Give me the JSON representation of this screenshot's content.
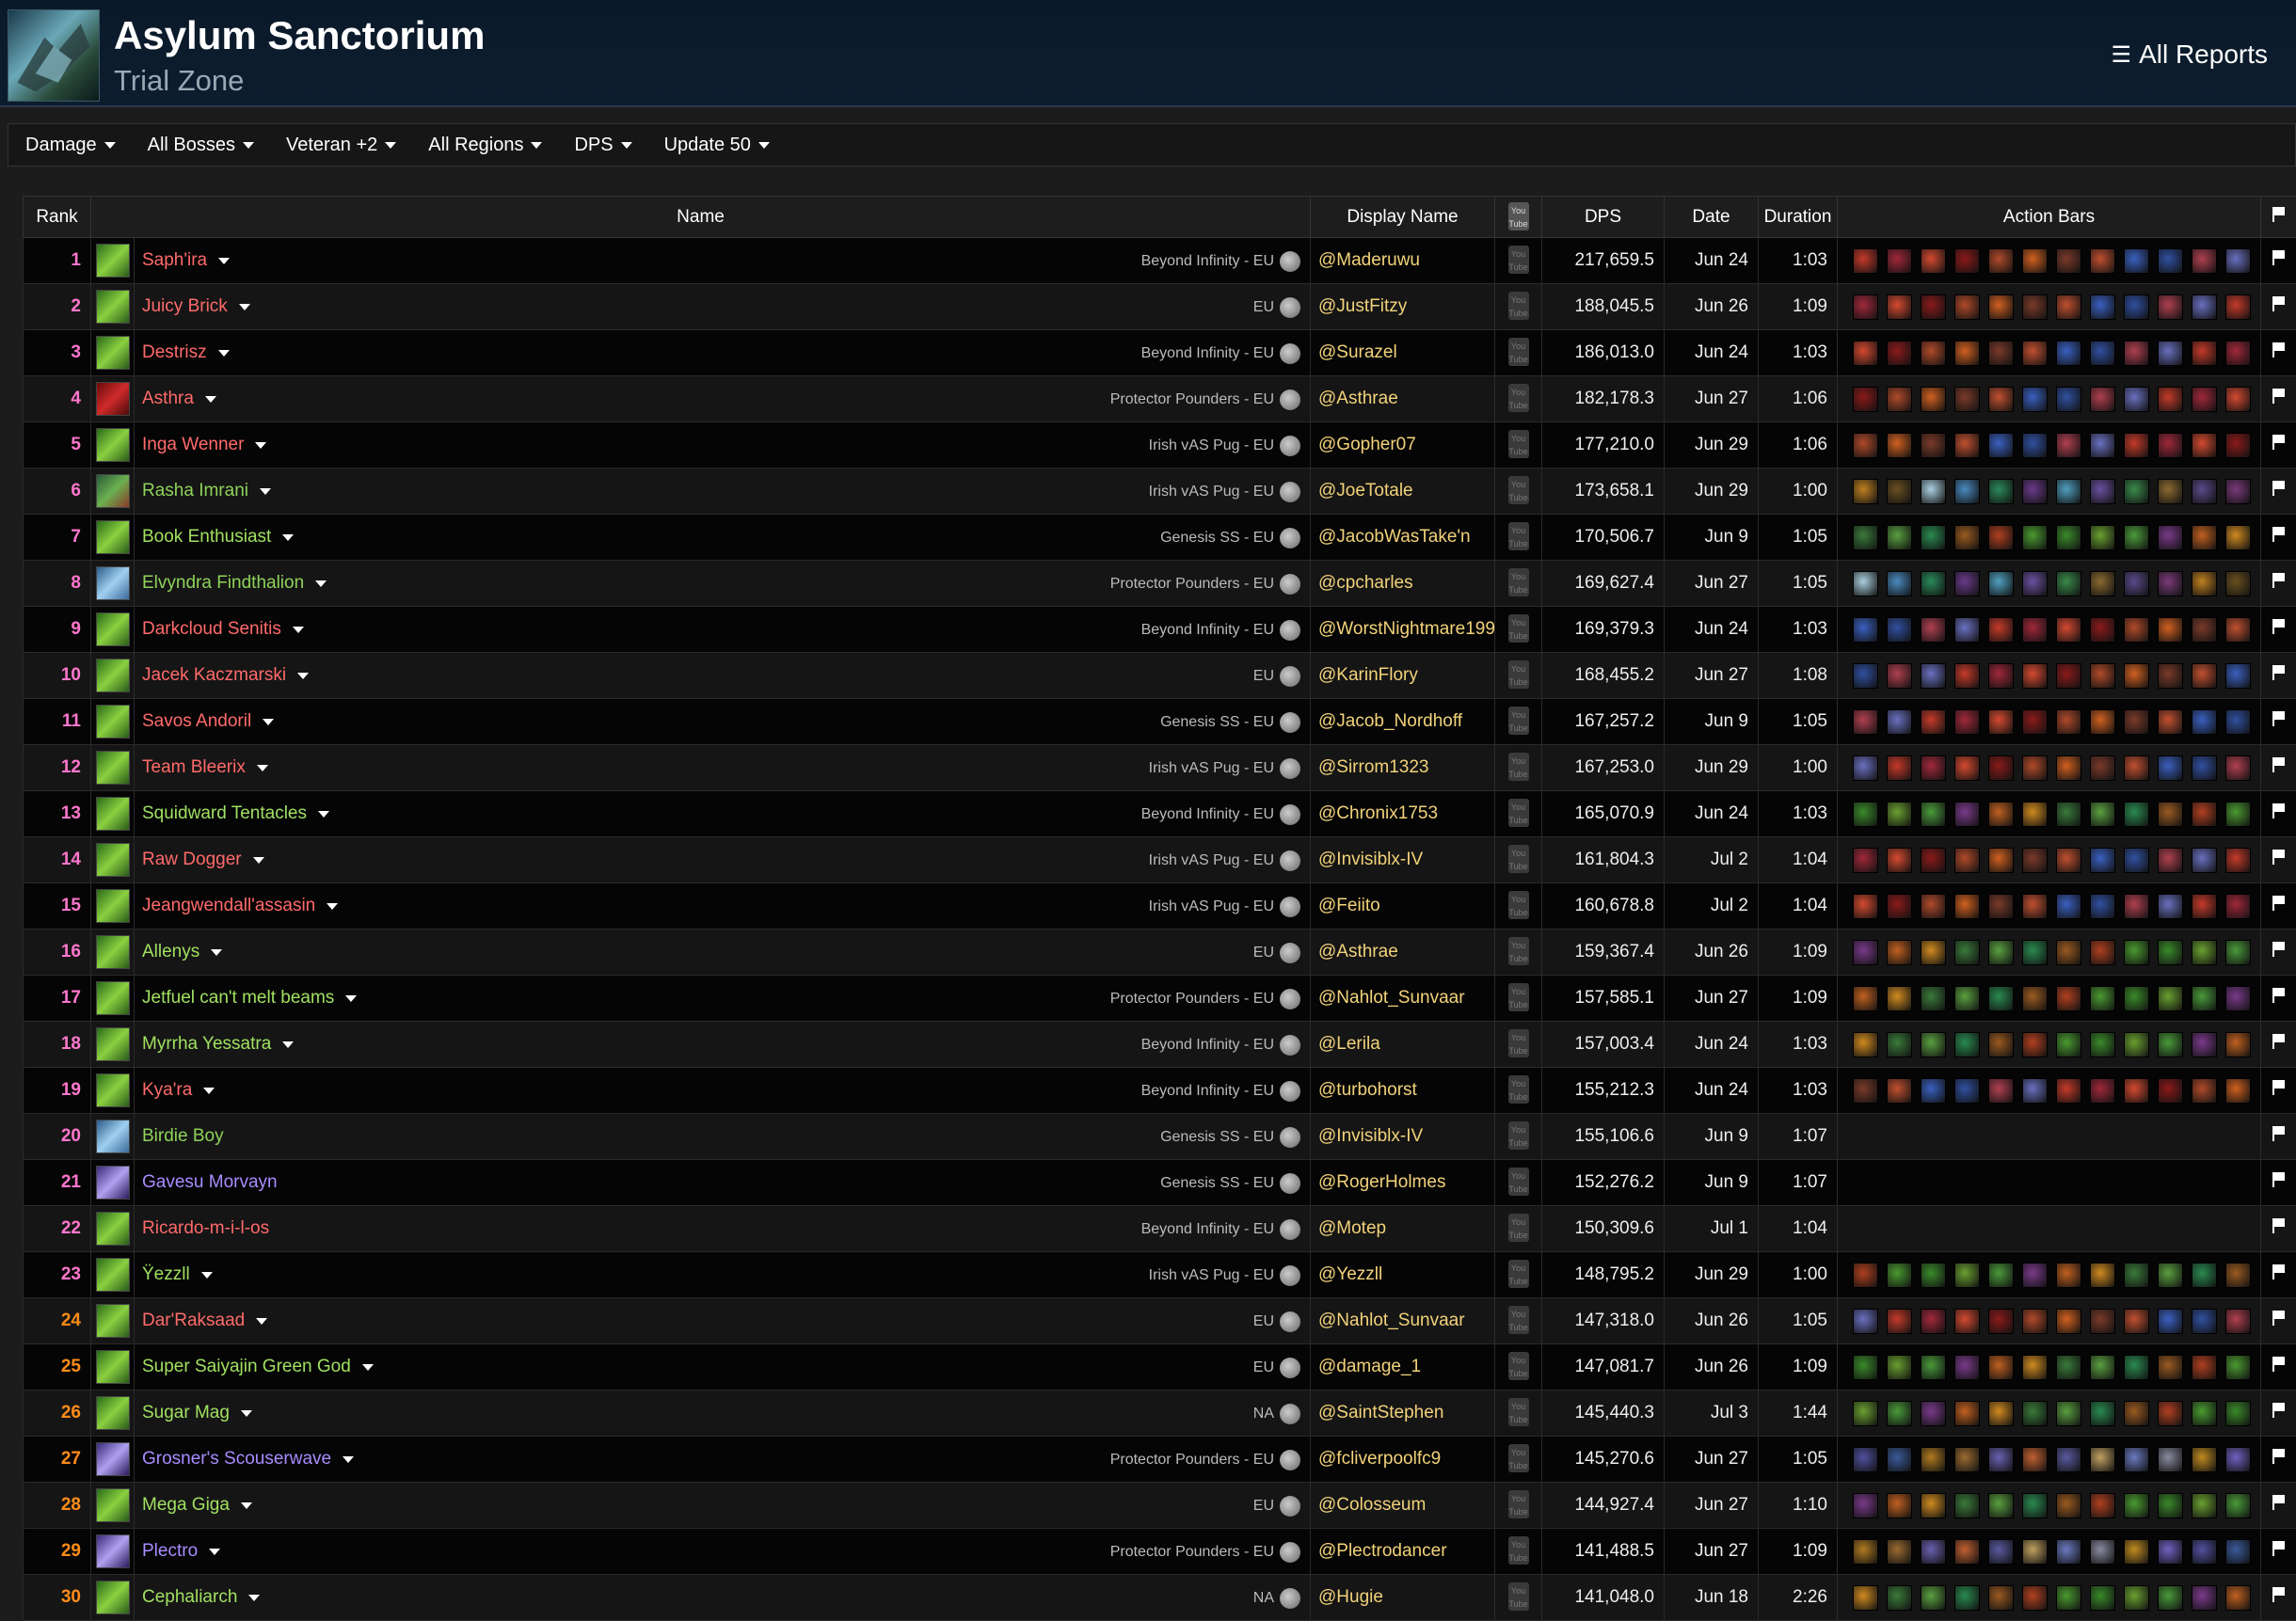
{
  "header": {
    "title": "Asylum Sanctorium",
    "subtitle": "Trial Zone",
    "all_reports": "All Reports"
  },
  "menu": [
    {
      "label": "Damage"
    },
    {
      "label": "All Bosses"
    },
    {
      "label": "Veteran +2"
    },
    {
      "label": "All Regions"
    },
    {
      "label": "DPS"
    },
    {
      "label": "Update 50"
    }
  ],
  "columns": {
    "rank": "Rank",
    "name": "Name",
    "display": "Display Name",
    "dps": "DPS",
    "date": "Date",
    "duration": "Duration",
    "bars": "Action Bars"
  },
  "rows": [
    {
      "rank": "1",
      "name": "Saph'ira",
      "guild": "Beyond Infinity - EU",
      "display": "@Maderuwu",
      "dps": "217,659.5",
      "date": "Jun 24",
      "dur": "1:03",
      "cls": "green",
      "nc": "red",
      "bars": "r"
    },
    {
      "rank": "2",
      "name": "Juicy Brick",
      "guild": "EU",
      "display": "@JustFitzy",
      "dps": "188,045.5",
      "date": "Jun 26",
      "dur": "1:09",
      "cls": "green",
      "nc": "red",
      "bars": "r"
    },
    {
      "rank": "3",
      "name": "Destrisz",
      "guild": "Beyond Infinity - EU",
      "display": "@Surazel",
      "dps": "186,013.0",
      "date": "Jun 24",
      "dur": "1:03",
      "cls": "green",
      "nc": "red",
      "bars": "r"
    },
    {
      "rank": "4",
      "name": "Asthra",
      "guild": "Protector Pounders - EU",
      "display": "@Asthrae",
      "dps": "182,178.3",
      "date": "Jun 27",
      "dur": "1:06",
      "cls": "red",
      "nc": "red",
      "bars": "r"
    },
    {
      "rank": "5",
      "name": "Inga Wenner",
      "guild": "Irish vAS Pug - EU",
      "display": "@Gopher07",
      "dps": "177,210.0",
      "date": "Jun 29",
      "dur": "1:06",
      "cls": "green",
      "nc": "red",
      "bars": "r"
    },
    {
      "rank": "6",
      "name": "Rasha Imrani",
      "guild": "Irish vAS Pug - EU",
      "display": "@JoeTotale",
      "dps": "173,658.1",
      "date": "Jun 29",
      "dur": "1:00",
      "cls": "green2",
      "nc": "lgreen",
      "bars": "m"
    },
    {
      "rank": "7",
      "name": "Book Enthusiast",
      "guild": "Genesis SS - EU",
      "display": "@JacobWasTake'n",
      "dps": "170,506.7",
      "date": "Jun 9",
      "dur": "1:05",
      "cls": "green",
      "nc": "green",
      "bars": "g"
    },
    {
      "rank": "8",
      "name": "Elvyndra Findthalion",
      "guild": "Protector Pounders - EU",
      "display": "@cpcharles",
      "dps": "169,627.4",
      "date": "Jun 27",
      "dur": "1:05",
      "cls": "blue",
      "nc": "lgreen",
      "bars": "m"
    },
    {
      "rank": "9",
      "name": "Darkcloud Senitis",
      "guild": "Beyond Infinity - EU",
      "display": "@WorstNightmare1991",
      "dps": "169,379.3",
      "date": "Jun 24",
      "dur": "1:03",
      "cls": "green",
      "nc": "red",
      "bars": "r"
    },
    {
      "rank": "10",
      "name": "Jacek Kaczmarski",
      "guild": "EU",
      "display": "@KarinFlory",
      "dps": "168,455.2",
      "date": "Jun 27",
      "dur": "1:08",
      "cls": "green",
      "nc": "red",
      "bars": "r"
    },
    {
      "rank": "11",
      "name": "Savos Andoril",
      "guild": "Genesis SS - EU",
      "display": "@Jacob_Nordhoff",
      "dps": "167,257.2",
      "date": "Jun 9",
      "dur": "1:05",
      "cls": "green",
      "nc": "red",
      "bars": "r"
    },
    {
      "rank": "12",
      "name": "Team Bleerix",
      "guild": "Irish vAS Pug - EU",
      "display": "@Sirrom1323",
      "dps": "167,253.0",
      "date": "Jun 29",
      "dur": "1:00",
      "cls": "green",
      "nc": "red",
      "bars": "r"
    },
    {
      "rank": "13",
      "name": "Squidward Tentacles",
      "guild": "Beyond Infinity - EU",
      "display": "@Chronix1753",
      "dps": "165,070.9",
      "date": "Jun 24",
      "dur": "1:03",
      "cls": "green",
      "nc": "green",
      "bars": "g"
    },
    {
      "rank": "14",
      "name": "Raw Dogger",
      "guild": "Irish vAS Pug - EU",
      "display": "@Invisiblx-IV",
      "dps": "161,804.3",
      "date": "Jul 2",
      "dur": "1:04",
      "cls": "green",
      "nc": "red",
      "bars": "r"
    },
    {
      "rank": "15",
      "name": "Jeangwendall'assasin",
      "guild": "Irish vAS Pug - EU",
      "display": "@Feiito",
      "dps": "160,678.8",
      "date": "Jul 2",
      "dur": "1:04",
      "cls": "green",
      "nc": "red",
      "bars": "r"
    },
    {
      "rank": "16",
      "name": "Allenys",
      "guild": "EU",
      "display": "@Asthrae",
      "dps": "159,367.4",
      "date": "Jun 26",
      "dur": "1:09",
      "cls": "green",
      "nc": "green",
      "bars": "g"
    },
    {
      "rank": "17",
      "name": "Jetfuel can't melt beams",
      "guild": "Protector Pounders - EU",
      "display": "@Nahlot_Sunvaar",
      "dps": "157,585.1",
      "date": "Jun 27",
      "dur": "1:09",
      "cls": "green",
      "nc": "green",
      "bars": "g"
    },
    {
      "rank": "18",
      "name": "Myrrha Yessatra",
      "guild": "Beyond Infinity - EU",
      "display": "@Lerila",
      "dps": "157,003.4",
      "date": "Jun 24",
      "dur": "1:03",
      "cls": "green",
      "nc": "green",
      "bars": "g"
    },
    {
      "rank": "19",
      "name": "Kya'ra",
      "guild": "Beyond Infinity - EU",
      "display": "@turbohorst",
      "dps": "155,212.3",
      "date": "Jun 24",
      "dur": "1:03",
      "cls": "green",
      "nc": "red",
      "bars": "r"
    },
    {
      "rank": "20",
      "name": "Birdie Boy",
      "guild": "Genesis SS - EU",
      "display": "@Invisiblx-IV",
      "dps": "155,106.6",
      "date": "Jun 9",
      "dur": "1:07",
      "cls": "blue",
      "nc": "lgreen",
      "bars": ""
    },
    {
      "rank": "21",
      "name": "Gavesu Morvayn",
      "guild": "Genesis SS - EU",
      "display": "@RogerHolmes",
      "dps": "152,276.2",
      "date": "Jun 9",
      "dur": "1:07",
      "cls": "purple",
      "nc": "purple",
      "bars": ""
    },
    {
      "rank": "22",
      "name": "Ricardo-m-i-l-os",
      "guild": "Beyond Infinity - EU",
      "display": "@Motep",
      "dps": "150,309.6",
      "date": "Jul 1",
      "dur": "1:04",
      "cls": "green",
      "nc": "red",
      "bars": ""
    },
    {
      "rank": "23",
      "name": "Ÿezzll",
      "guild": "Irish vAS Pug - EU",
      "display": "@Yezzll",
      "dps": "148,795.2",
      "date": "Jun 29",
      "dur": "1:00",
      "cls": "green",
      "nc": "green",
      "bars": "g"
    },
    {
      "rank": "24",
      "name": "Dar'Raksaad",
      "guild": "EU",
      "display": "@Nahlot_Sunvaar",
      "dps": "147,318.0",
      "date": "Jun 26",
      "dur": "1:05",
      "cls": "green",
      "nc": "red",
      "bars": "r"
    },
    {
      "rank": "25",
      "name": "Super Saiyajin Green God",
      "guild": "EU",
      "display": "@damage_1",
      "dps": "147,081.7",
      "date": "Jun 26",
      "dur": "1:09",
      "cls": "green",
      "nc": "green",
      "bars": "g"
    },
    {
      "rank": "26",
      "name": "Sugar Mag",
      "guild": "NA",
      "display": "@SaintStephen",
      "dps": "145,440.3",
      "date": "Jul 3",
      "dur": "1:44",
      "cls": "green",
      "nc": "green",
      "bars": "g"
    },
    {
      "rank": "27",
      "name": "Grosner's Scouserwave",
      "guild": "Protector Pounders - EU",
      "display": "@fcliverpoolfc9",
      "dps": "145,270.6",
      "date": "Jun 27",
      "dur": "1:05",
      "cls": "purple",
      "nc": "purple",
      "bars": "p"
    },
    {
      "rank": "28",
      "name": "Mega Giga",
      "guild": "EU",
      "display": "@Colosseum",
      "dps": "144,927.4",
      "date": "Jun 27",
      "dur": "1:10",
      "cls": "green",
      "nc": "green",
      "bars": "g"
    },
    {
      "rank": "29",
      "name": "Plectro",
      "guild": "Protector Pounders - EU",
      "display": "@Plectrodancer",
      "dps": "141,488.5",
      "date": "Jun 27",
      "dur": "1:09",
      "cls": "purple",
      "nc": "purple",
      "bars": "p"
    },
    {
      "rank": "30",
      "name": "Cephaliarch",
      "guild": "NA",
      "display": "@Hugie",
      "dps": "141,048.0",
      "date": "Jun 18",
      "dur": "2:26",
      "cls": "green",
      "nc": "green",
      "bars": "g"
    }
  ],
  "colors": {
    "rank_pink": "#ff77cc",
    "rank_orange": "#ff8c1a",
    "display_gold": "#f2d27a",
    "name_red": "#ff6a6a",
    "name_green": "#a0e060",
    "name_purple": "#a88cff"
  },
  "icons": {
    "all_reports": "list-icon",
    "flag": "flag-icon",
    "youtube": "youtube-icon",
    "globe": "globe-icon"
  }
}
